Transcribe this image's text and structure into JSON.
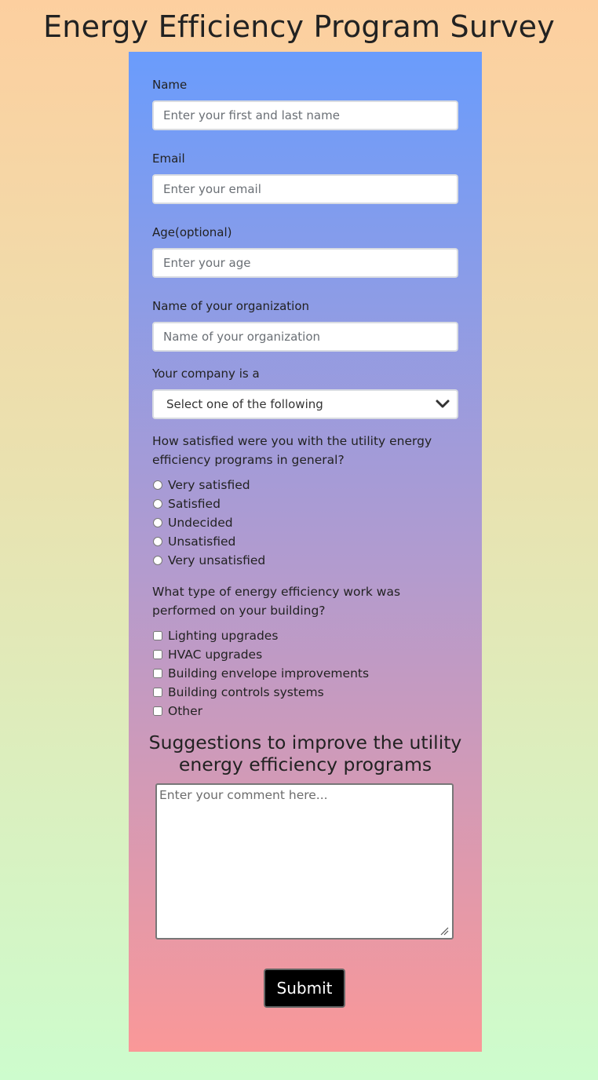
{
  "page": {
    "title": "Energy Efficiency Program Survey"
  },
  "form": {
    "name": {
      "label": "Name",
      "placeholder": "Enter your first and last name",
      "value": ""
    },
    "email": {
      "label": "Email",
      "placeholder": "Enter your email",
      "value": ""
    },
    "age": {
      "label": "Age(optional)",
      "placeholder": "Enter your age",
      "value": ""
    },
    "organization": {
      "label": "Name of your organization",
      "placeholder": "Name of your organization",
      "value": ""
    },
    "company_type": {
      "label": "Your company is a",
      "selected": "Select one of the following",
      "icon": "chevron-down-icon"
    },
    "satisfaction": {
      "question": "How satisfied were you with the utility energy efficiency programs in general?",
      "options": [
        {
          "label": "Very satisfied",
          "checked": false
        },
        {
          "label": "Satisfied",
          "checked": false
        },
        {
          "label": "Undecided",
          "checked": false
        },
        {
          "label": "Unsatisfied",
          "checked": false
        },
        {
          "label": "Very unsatisfied",
          "checked": false
        }
      ]
    },
    "work_type": {
      "question": "What type of energy efficiency work was performed on your building?",
      "options": [
        {
          "label": "Lighting upgrades",
          "checked": false
        },
        {
          "label": "HVAC upgrades",
          "checked": false
        },
        {
          "label": "Building envelope improvements",
          "checked": false
        },
        {
          "label": "Building controls systems",
          "checked": false
        },
        {
          "label": "Other",
          "checked": false
        }
      ]
    },
    "suggestions": {
      "heading": "Suggestions to improve the utility energy efficiency programs",
      "placeholder": "Enter your comment here...",
      "value": ""
    },
    "submit_label": "Submit"
  },
  "colors": {
    "page_gradient_top": "#fdcf9f",
    "page_gradient_bottom": "#cdfccd",
    "panel_gradient_top": "#6a9cfc",
    "panel_gradient_bottom": "#fa9898",
    "submit_background": "#000000"
  }
}
